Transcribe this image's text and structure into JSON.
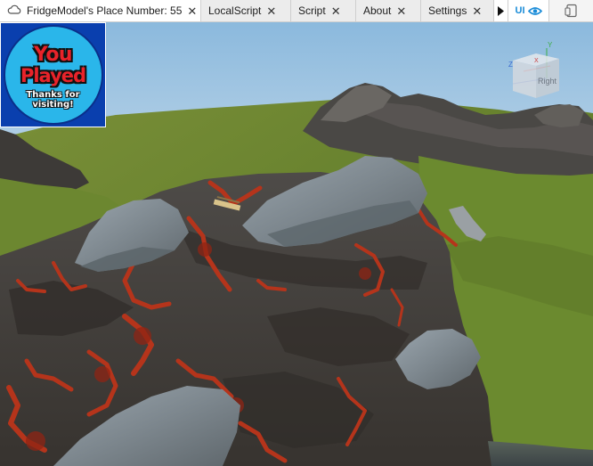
{
  "tabs": [
    {
      "label": "FridgeModel's Place Number: 55",
      "icon": "cloud-icon",
      "active": true
    },
    {
      "label": "LocalScript"
    },
    {
      "label": "Script"
    },
    {
      "label": "About"
    },
    {
      "label": "Settings"
    }
  ],
  "toolbar": {
    "ui_label": "UI",
    "play_icon": "play-arrow-icon",
    "eye_icon": "eye-icon",
    "device_icon": "device-emulator-icon"
  },
  "badge": {
    "line1": "You",
    "line2": "Played",
    "line3": "Thanks for visiting!"
  },
  "viewcube": {
    "face_label": "Right",
    "axis_y": "Y",
    "axis_z": "Z",
    "axis_x": "X"
  },
  "colors": {
    "accent": "#1a8cd8",
    "grass": "#6f8a2c",
    "rock": "#4a4642",
    "lava": "#b5341b",
    "sky": "#9fc6e4"
  }
}
